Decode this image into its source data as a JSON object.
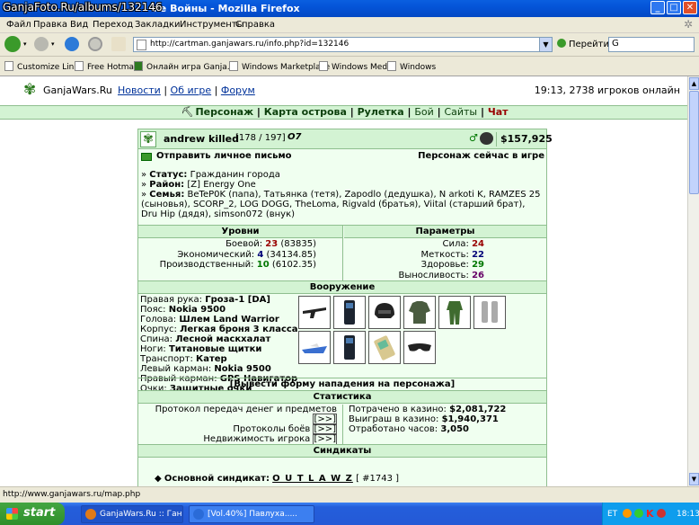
{
  "window": {
    "title": "GanjaWars.Ru :: Ган... ...ие Войны - Mozilla Firefox",
    "title_visible": "ие Войны - Mozilla Firefox",
    "watermark": "GanjaFoto.Ru/albums/132146"
  },
  "menu": [
    "Файл",
    "Правка",
    "Вид",
    "Переход",
    "Закладки",
    "Инструменты",
    "Справка"
  ],
  "nav": {
    "url": "http://cartman.ganjawars.ru/info.php?id=132146",
    "go_label": "Перейти",
    "search_value": "G"
  },
  "bookmarks": [
    "Customize Links",
    "Free Hotmail",
    "Онлайн игра Ganja...",
    "Windows Marketplace",
    "Windows Media",
    "Windows"
  ],
  "site": {
    "logo": "GanjaWars.Ru",
    "links": [
      "Новости",
      "Об игре",
      "Форум"
    ],
    "clock": "19:13, 2738 игроков онлайн",
    "main_menu": [
      {
        "label": "Персонаж",
        "bold": true
      },
      {
        "label": "Карта острова",
        "bold": true
      },
      {
        "label": "Рулетка",
        "bold": true
      },
      {
        "label": "Бой",
        "bold": false
      },
      {
        "label": "Сайты",
        "bold": false
      },
      {
        "label": "Чат",
        "bold": true
      }
    ]
  },
  "profile": {
    "name": "andrew killed",
    "hp": "[178 / 197]",
    "sign": "O7",
    "money": "$157,925",
    "send_message": "Отправить личное письмо",
    "online_status": "Персонаж сейчас в игре",
    "status_label": "Статус:",
    "status_value": "Гражданин города",
    "district_label": "Район:",
    "district_value": "[Z] Energy One",
    "family_label": "Семья:",
    "family_value": "BeTeP0K (папа), Татьянка (тетя), Zapodlo (дедушка), N arkoti K, RAMZES 25 (сыновья), SCORP_2, LOG DOGG, TheLoma, Rigvald (братья), Viital (старший брат), Dru Hip (дядя), simson072 (внук)"
  },
  "levels": {
    "title": "Уровни",
    "rows": [
      {
        "label": "Боевой:",
        "value": "23",
        "extra": "(83835)"
      },
      {
        "label": "Экономический:",
        "value": "4",
        "extra": "(34134.85)"
      },
      {
        "label": "Производственный:",
        "value": "10",
        "extra": "(6102.35)"
      }
    ]
  },
  "params": {
    "title": "Параметры",
    "rows": [
      {
        "label": "Сила:",
        "value": "24"
      },
      {
        "label": "Меткость:",
        "value": "22"
      },
      {
        "label": "Здоровье:",
        "value": "29"
      },
      {
        "label": "Выносливость:",
        "value": "26"
      }
    ]
  },
  "weapons": {
    "title": "Вооружение",
    "rows": [
      {
        "label": "Правая рука:",
        "value": "Гроза-1 [DA]"
      },
      {
        "label": "Пояс:",
        "value": "Nokia 9500"
      },
      {
        "label": "Голова:",
        "value": "Шлем Land Warrior"
      },
      {
        "label": "Корпус:",
        "value": "Легкая броня 3 класса"
      },
      {
        "label": "Спина:",
        "value": "Лесной маскхалат"
      },
      {
        "label": "Ноги:",
        "value": "Титановые щитки"
      },
      {
        "label": "Транспорт:",
        "value": "Катер"
      },
      {
        "label": "Левый карман:",
        "value": "Nokia 9500"
      },
      {
        "label": "Правый карман:",
        "value": "GPS Навигатор"
      },
      {
        "label": "Очки:",
        "value": "Защитные очки"
      }
    ],
    "attack_form": "[Вывести форму нападения на персонажа]"
  },
  "stats": {
    "title": "Статистика",
    "links": [
      "Протокол передач денег и предметов",
      "Протоколы боёв",
      "Недвижимость игрока"
    ],
    "link_btn": "[>>]",
    "rows": [
      {
        "label": "Потрачено в казино:",
        "value": "$2,081,722"
      },
      {
        "label": "Выиграш в казино:",
        "value": "$1,940,371"
      },
      {
        "label": "Отработано часов:",
        "value": "3,050"
      }
    ]
  },
  "syndicates": {
    "title": "Синдикаты",
    "main_label": "Основной синдикат:",
    "main_name": "O U T L A W Z",
    "main_id": "[ #1743 ]"
  },
  "statusbar": "http://www.ganjawars.ru/map.php",
  "taskbar": {
    "start": "start",
    "tasks": [
      "GanjaWars.Ru :: Ган...",
      "[Vol.40%] Павлуха....."
    ],
    "lang": "ET",
    "time": "18:13"
  },
  "colors": {
    "accent": "#d3f3d3",
    "border": "#8fbf8f",
    "red": "#990000"
  }
}
